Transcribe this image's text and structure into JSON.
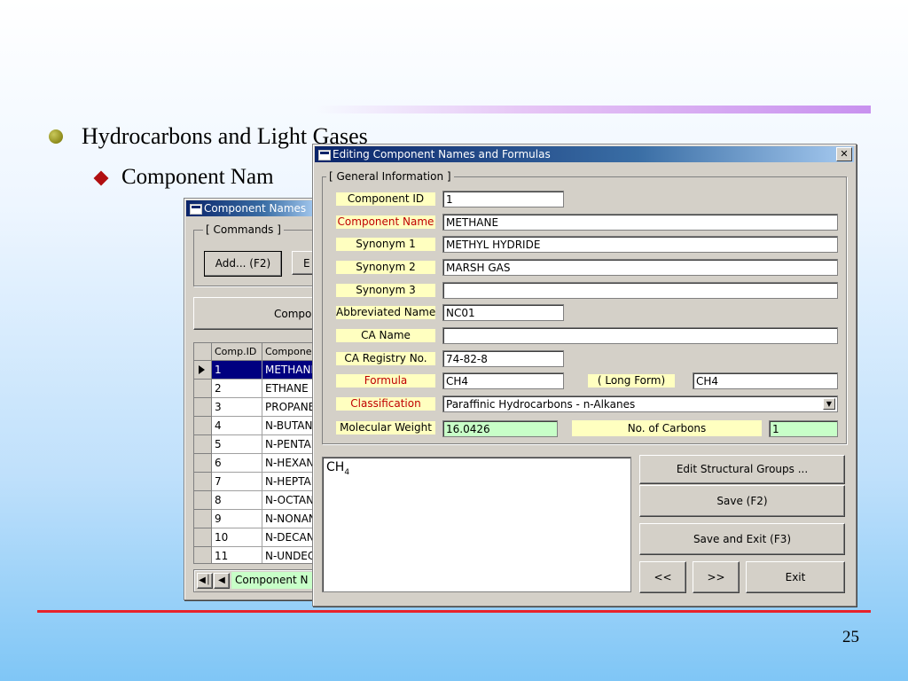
{
  "slide": {
    "bullet1": "Hydrocarbons and Light Gases",
    "bullet2": "Component Nam",
    "page_number": "25"
  },
  "bg_window": {
    "title": "Component Names",
    "commands_group": "[ Commands ]",
    "add_button": "Add... (F2)",
    "edit_button_partial": "E",
    "wide_button_partial": "Compo",
    "grid": {
      "headers": [
        "Comp.ID",
        "Componen"
      ],
      "rows": [
        {
          "id": "1",
          "name": "METHANE"
        },
        {
          "id": "2",
          "name": "ETHANE"
        },
        {
          "id": "3",
          "name": "PROPANE"
        },
        {
          "id": "4",
          "name": "N-BUTANE"
        },
        {
          "id": "5",
          "name": "N-PENTAN"
        },
        {
          "id": "6",
          "name": "N-HEXANE"
        },
        {
          "id": "7",
          "name": "N-HEPTAN"
        },
        {
          "id": "8",
          "name": "N-OCTANE"
        },
        {
          "id": "9",
          "name": "N-NONAN"
        },
        {
          "id": "10",
          "name": "N-DECANE"
        },
        {
          "id": "11",
          "name": "N-UNDEC"
        }
      ]
    },
    "nav_label": "Component N"
  },
  "dialog": {
    "title": "Editing Component Names and Formulas",
    "close_glyph": "✕",
    "group_label": "[ General Information ]",
    "labels": {
      "component_id": "Component ID",
      "component_name": "Component Name",
      "synonym1": "Synonym 1",
      "synonym2": "Synonym 2",
      "synonym3": "Synonym 3",
      "abbreviated_name": "Abbreviated Name",
      "ca_name": "CA Name",
      "ca_registry": "CA Registry No.",
      "formula": "Formula",
      "long_form": "( Long Form)",
      "classification": "Classification",
      "molecular_weight": "Molecular Weight",
      "no_of_carbons": "No. of Carbons"
    },
    "values": {
      "component_id": "1",
      "component_name": "METHANE",
      "synonym1": "METHYL HYDRIDE",
      "synonym2": "MARSH GAS",
      "synonym3": "",
      "abbreviated_name": "NC01",
      "ca_name": "",
      "ca_registry": "74-82-8",
      "formula": "CH4",
      "long_form": "CH4",
      "classification": "Paraffinic Hydrocarbons - n-Alkanes",
      "molecular_weight": "16.0426",
      "no_of_carbons": "1"
    },
    "memo": {
      "base": "CH",
      "sub": "4"
    },
    "buttons": {
      "edit_groups": "Edit Structural Groups ...",
      "save": "Save (F2)",
      "save_exit": "Save and Exit (F3)",
      "prev": "<<",
      "next": ">>",
      "exit": "Exit"
    }
  }
}
